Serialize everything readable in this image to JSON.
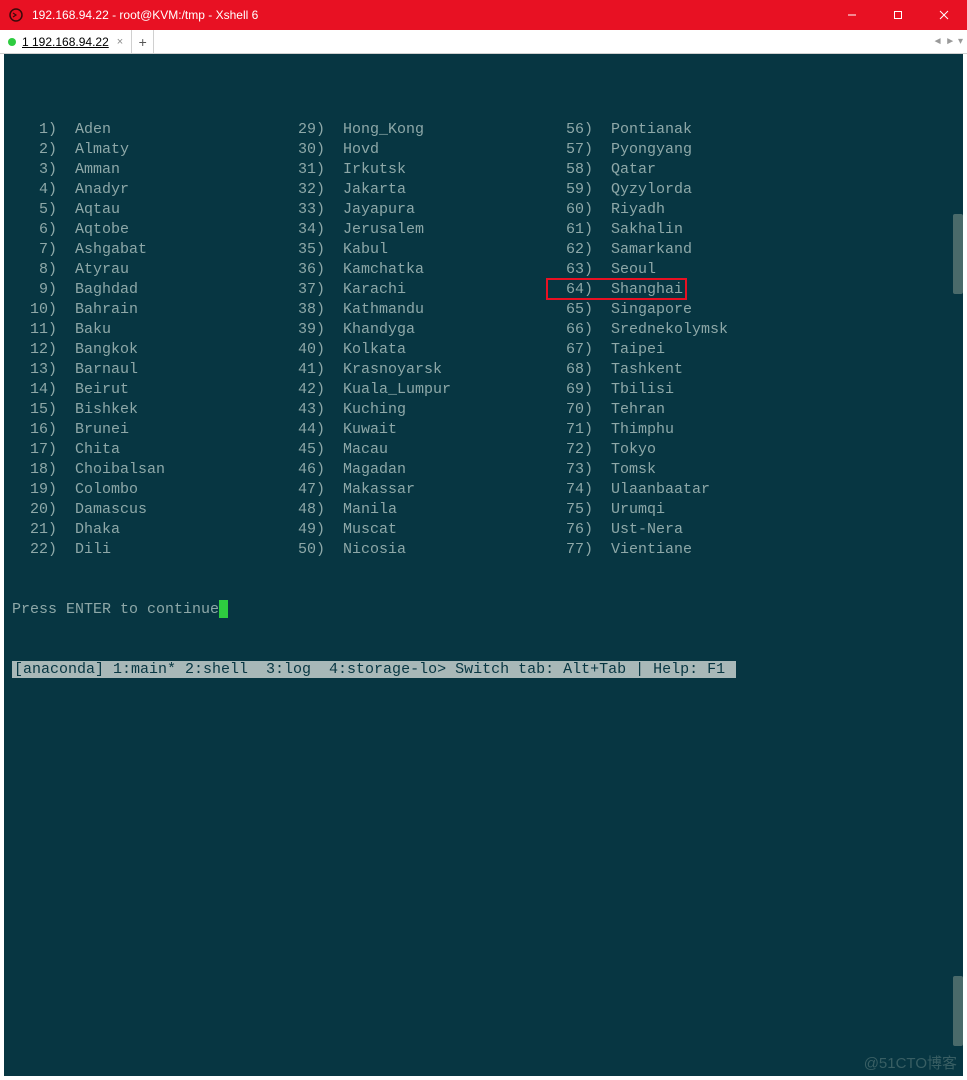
{
  "window": {
    "title": "192.168.94.22 - root@KVM:/tmp - Xshell 6"
  },
  "tabs": {
    "active_label": "1 192.168.94.22"
  },
  "terminal": {
    "columns": [
      [
        {
          "n": "1",
          "name": "Aden"
        },
        {
          "n": "2",
          "name": "Almaty"
        },
        {
          "n": "3",
          "name": "Amman"
        },
        {
          "n": "4",
          "name": "Anadyr"
        },
        {
          "n": "5",
          "name": "Aqtau"
        },
        {
          "n": "6",
          "name": "Aqtobe"
        },
        {
          "n": "7",
          "name": "Ashgabat"
        },
        {
          "n": "8",
          "name": "Atyrau"
        },
        {
          "n": "9",
          "name": "Baghdad"
        },
        {
          "n": "10",
          "name": "Bahrain"
        },
        {
          "n": "11",
          "name": "Baku"
        },
        {
          "n": "12",
          "name": "Bangkok"
        },
        {
          "n": "13",
          "name": "Barnaul"
        },
        {
          "n": "14",
          "name": "Beirut"
        },
        {
          "n": "15",
          "name": "Bishkek"
        },
        {
          "n": "16",
          "name": "Brunei"
        },
        {
          "n": "17",
          "name": "Chita"
        },
        {
          "n": "18",
          "name": "Choibalsan"
        },
        {
          "n": "19",
          "name": "Colombo"
        },
        {
          "n": "20",
          "name": "Damascus"
        },
        {
          "n": "21",
          "name": "Dhaka"
        },
        {
          "n": "22",
          "name": "Dili"
        }
      ],
      [
        {
          "n": "29",
          "name": "Hong_Kong"
        },
        {
          "n": "30",
          "name": "Hovd"
        },
        {
          "n": "31",
          "name": "Irkutsk"
        },
        {
          "n": "32",
          "name": "Jakarta"
        },
        {
          "n": "33",
          "name": "Jayapura"
        },
        {
          "n": "34",
          "name": "Jerusalem"
        },
        {
          "n": "35",
          "name": "Kabul"
        },
        {
          "n": "36",
          "name": "Kamchatka"
        },
        {
          "n": "37",
          "name": "Karachi"
        },
        {
          "n": "38",
          "name": "Kathmandu"
        },
        {
          "n": "39",
          "name": "Khandyga"
        },
        {
          "n": "40",
          "name": "Kolkata"
        },
        {
          "n": "41",
          "name": "Krasnoyarsk"
        },
        {
          "n": "42",
          "name": "Kuala_Lumpur"
        },
        {
          "n": "43",
          "name": "Kuching"
        },
        {
          "n": "44",
          "name": "Kuwait"
        },
        {
          "n": "45",
          "name": "Macau"
        },
        {
          "n": "46",
          "name": "Magadan"
        },
        {
          "n": "47",
          "name": "Makassar"
        },
        {
          "n": "48",
          "name": "Manila"
        },
        {
          "n": "49",
          "name": "Muscat"
        },
        {
          "n": "50",
          "name": "Nicosia"
        }
      ],
      [
        {
          "n": "56",
          "name": "Pontianak"
        },
        {
          "n": "57",
          "name": "Pyongyang"
        },
        {
          "n": "58",
          "name": "Qatar"
        },
        {
          "n": "59",
          "name": "Qyzylorda"
        },
        {
          "n": "60",
          "name": "Riyadh"
        },
        {
          "n": "61",
          "name": "Sakhalin"
        },
        {
          "n": "62",
          "name": "Samarkand"
        },
        {
          "n": "63",
          "name": "Seoul"
        },
        {
          "n": "64",
          "name": "Shanghai"
        },
        {
          "n": "65",
          "name": "Singapore"
        },
        {
          "n": "66",
          "name": "Srednekolymsk"
        },
        {
          "n": "67",
          "name": "Taipei"
        },
        {
          "n": "68",
          "name": "Tashkent"
        },
        {
          "n": "69",
          "name": "Tbilisi"
        },
        {
          "n": "70",
          "name": "Tehran"
        },
        {
          "n": "71",
          "name": "Thimphu"
        },
        {
          "n": "72",
          "name": "Tokyo"
        },
        {
          "n": "73",
          "name": "Tomsk"
        },
        {
          "n": "74",
          "name": "Ulaanbaatar"
        },
        {
          "n": "75",
          "name": "Urumqi"
        },
        {
          "n": "76",
          "name": "Ust-Nera"
        },
        {
          "n": "77",
          "name": "Vientiane"
        }
      ]
    ],
    "prompt": "Press ENTER to continue",
    "statusbar": "[anaconda] 1:main* 2:shell  3:log  4:storage-lo> Switch tab: Alt+Tab | Help: F1 ",
    "highlighted_index": {
      "col": 2,
      "row": 8
    }
  },
  "watermark": "@51CTO博客"
}
